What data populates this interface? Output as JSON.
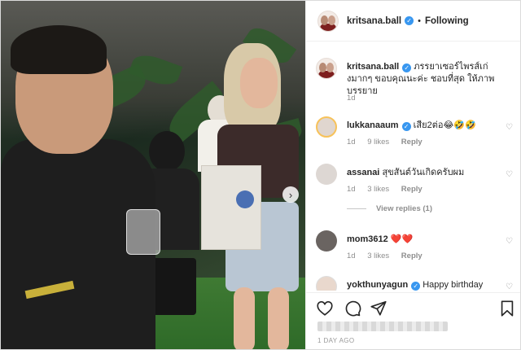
{
  "post": {
    "username": "kritsana.ball",
    "verified": true,
    "separator": "•",
    "follow_status": "Following",
    "caption": "ภรรยาเซอร์ไพรส์เก่งมากๆ ขอบคุณนะค่ะ ชอบที่สุด ให้ภาพบรรยาย",
    "caption_age": "1d",
    "date": "1 DAY AGO"
  },
  "comments": [
    {
      "user": "lukkanaaum",
      "verified": true,
      "text": "เสีย2ต่อ😂🤣🤣",
      "age": "1d",
      "likes": "9 likes",
      "reply": "Reply"
    },
    {
      "user": "assanai",
      "verified": false,
      "text": "สุขสันต์วันเกิดครับผม",
      "age": "1d",
      "likes": "3 likes",
      "reply": "Reply"
    },
    {
      "user": "mom3612",
      "verified": false,
      "text": "❤️❤️",
      "age": "1d",
      "likes": "3 likes",
      "reply": "Reply"
    },
    {
      "user": "yokthunyagun",
      "verified": true,
      "text": "Happy birthday",
      "age": "",
      "likes": "",
      "reply": ""
    }
  ],
  "view_replies": "View replies (1)",
  "icons": {
    "verified": "verified-badge-icon",
    "heart": "heart-icon",
    "comment": "comment-icon",
    "share": "share-icon",
    "save": "bookmark-icon",
    "next": "chevron-right-icon"
  },
  "colors": {
    "verified": "#3897f0",
    "muted": "#8e8e8e",
    "border": "#efefef"
  }
}
